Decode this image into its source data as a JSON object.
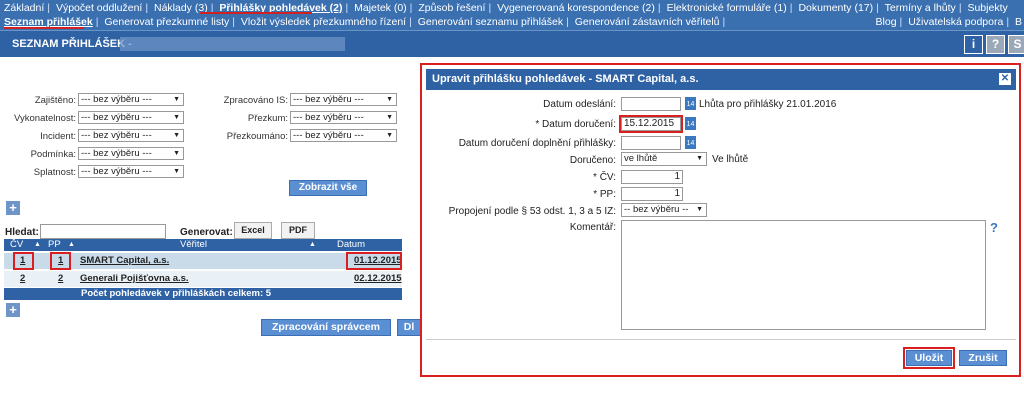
{
  "nav": {
    "row1": [
      "Základní",
      "Výpočet oddlužení",
      "Náklady (3)",
      "Přihlášky pohledávek (2)",
      "Majetek (0)",
      "Způsob řešení",
      "Vygenerovaná korespondence (2)",
      "Elektronické formuláře (1)",
      "Dokumenty (17)",
      "Termíny a lhůty",
      "Subjekty"
    ],
    "row2": [
      "Seznam přihlášek",
      "Generovat přezkumné listy",
      "Vložit výsledek přezkumného řízení",
      "Generování seznamu přihlášek",
      "Generování zástavních věřitelů"
    ],
    "right": [
      "Blog",
      "Uživatelská podpora",
      "B"
    ]
  },
  "header": {
    "title": "SEZNAM PŘIHLÁŠEK -",
    "buttons": [
      "i",
      "?",
      "S"
    ]
  },
  "filters": {
    "left": [
      {
        "label": "Zajištěno:",
        "value": "--- bez výběru ---"
      },
      {
        "label": "Vykonatelnost:",
        "value": "--- bez výběru ---"
      },
      {
        "label": "Incident:",
        "value": "--- bez výběru ---"
      },
      {
        "label": "Podmínka:",
        "value": "--- bez výběru ---"
      },
      {
        "label": "Splatnost:",
        "value": "--- bez výběru ---"
      }
    ],
    "right": [
      {
        "label": "Zpracováno IS:",
        "value": "--- bez výběru ---"
      },
      {
        "label": "Přezkum:",
        "value": "--- bez výběru ---"
      },
      {
        "label": "Přezkoumáno:",
        "value": "--- bez výběru ---"
      }
    ],
    "show_all": "Zobrazit vše"
  },
  "search": {
    "label": "Hledat:",
    "generate_label": "Generovat:",
    "excel": "Excel",
    "pdf": "PDF"
  },
  "table": {
    "headers": [
      "ČV",
      "PP",
      "Věřitel",
      "Datum doručení"
    ],
    "rows": [
      {
        "cv": "1",
        "pp": "1",
        "creditor": "SMART Capital, a.s.",
        "date": "01.12.2015"
      },
      {
        "cv": "2",
        "pp": "2",
        "creditor": "Generali Pojišťovna a.s.",
        "date": "02.12.2015"
      }
    ],
    "total": "Počet pohledávek v přihláškách celkem: 5"
  },
  "bottom_buttons": [
    "Zpracování správcem",
    "Dl"
  ],
  "modal": {
    "title": "Upravit přihlášku pohledávek - SMART Capital, a.s.",
    "fields": {
      "sent_label": "Datum odeslání:",
      "deadline_text": "Lhůta pro přihlášky 21.01.2016",
      "delivered_label": "* Datum doručení:",
      "delivered_value": "15.12.2015",
      "supplement_label": "Datum doručení doplnění přihlášky:",
      "delivery_label": "Doručeno:",
      "delivery_value": "ve lhůtě",
      "delivery_text": "Ve lhůtě",
      "cv_label": "* ČV:",
      "cv_value": "1",
      "pp_label": "* PP:",
      "pp_value": "1",
      "link_label": "Propojení podle § 53 odst. 1, 3 a 5 IZ:",
      "link_value": "-- bez výběru --",
      "comment_label": "Komentář:",
      "help": "?"
    },
    "save": "Uložit",
    "cancel": "Zrušit"
  }
}
